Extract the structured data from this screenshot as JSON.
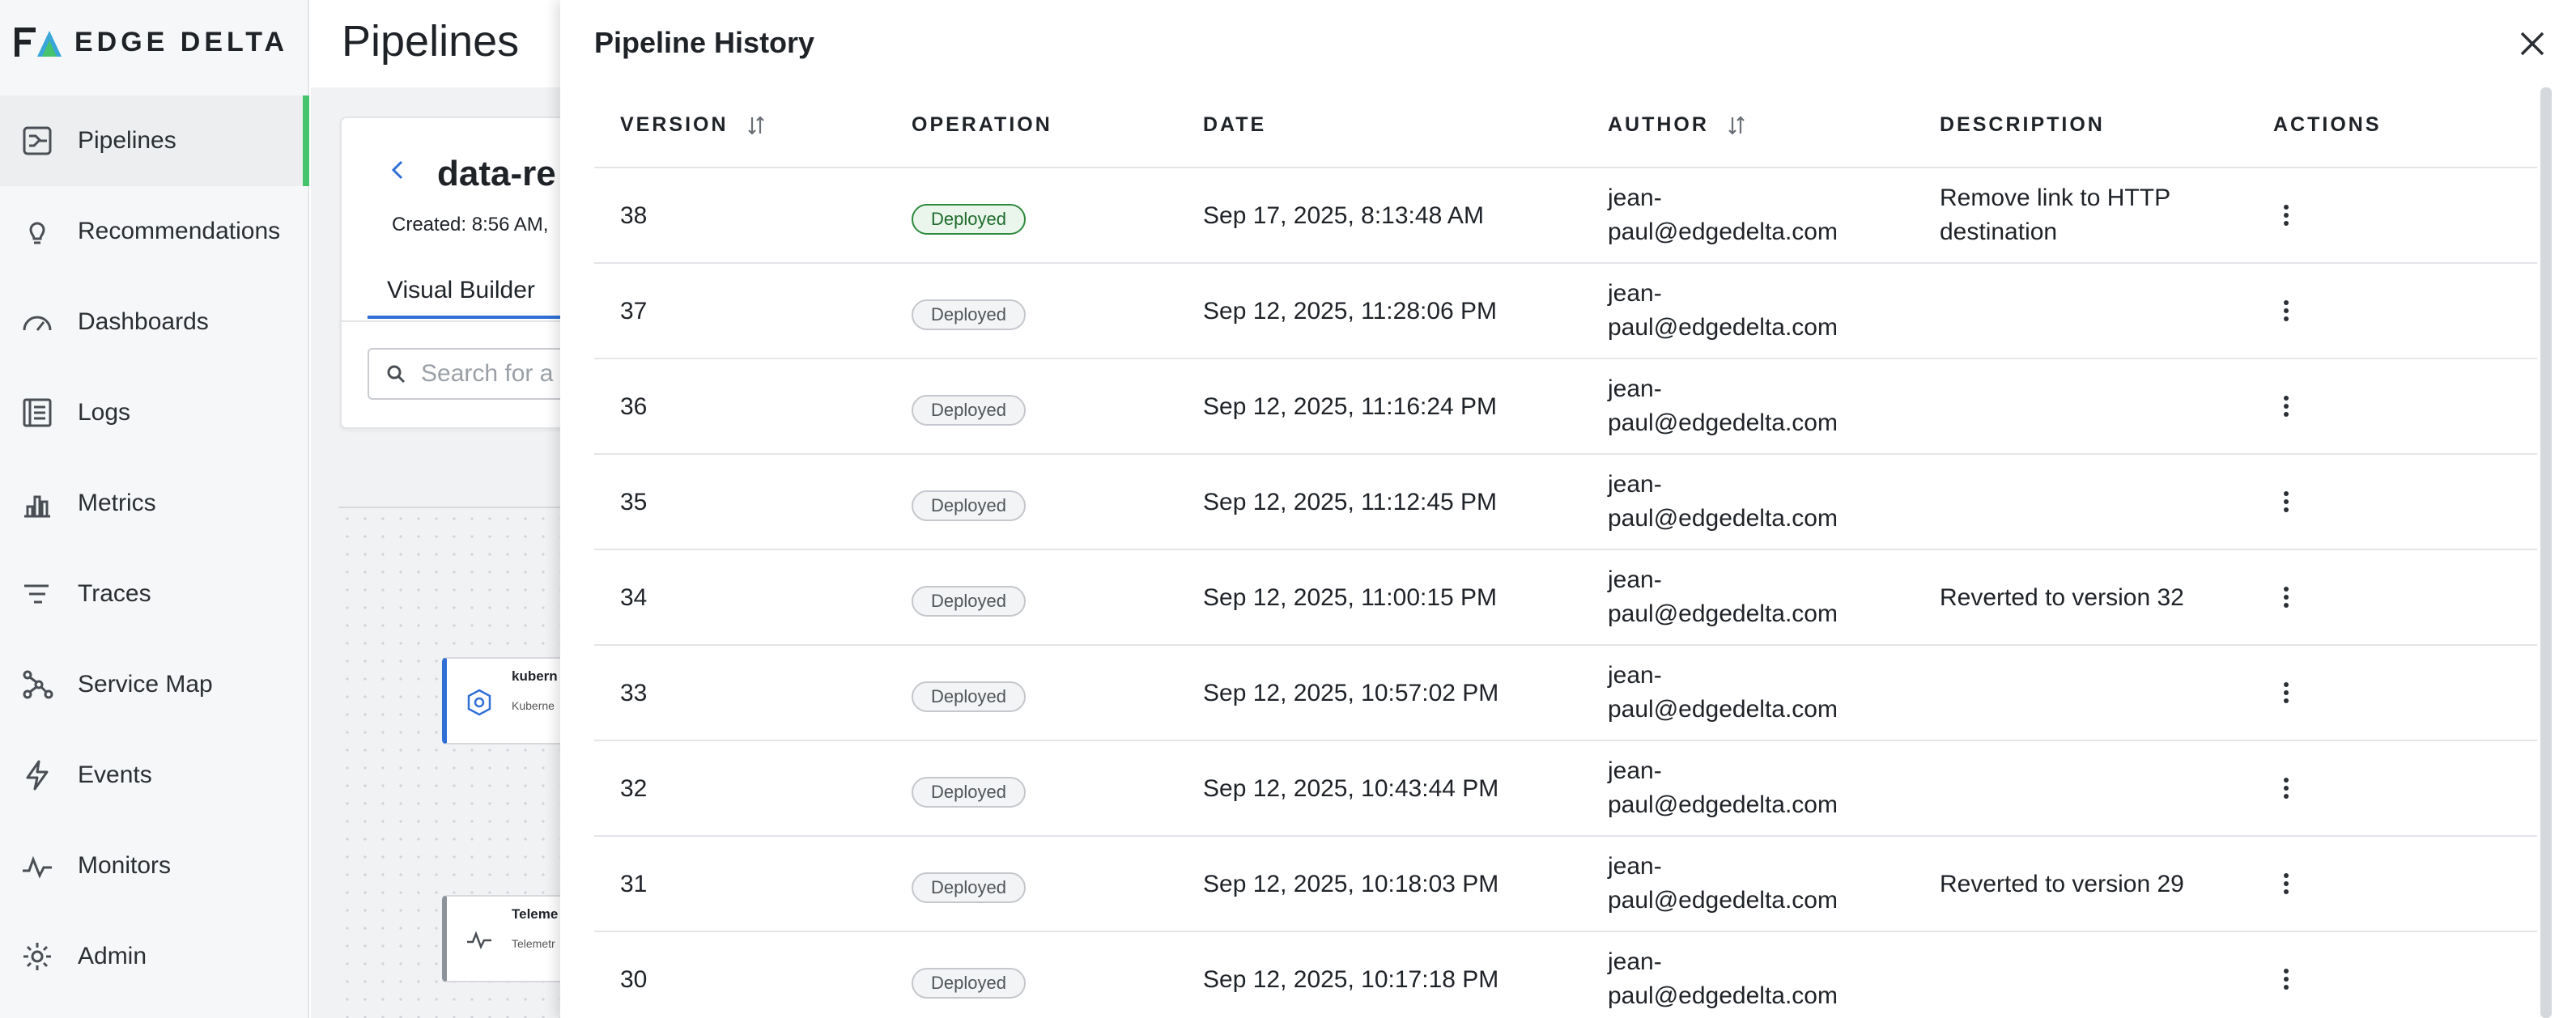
{
  "brand": {
    "name": "EDGE DELTA"
  },
  "sidebar": {
    "items": [
      {
        "label": "Pipelines",
        "icon": "pipelines-icon",
        "active": true
      },
      {
        "label": "Recommendations",
        "icon": "lightbulb-icon",
        "active": false
      },
      {
        "label": "Dashboards",
        "icon": "gauge-icon",
        "active": false
      },
      {
        "label": "Logs",
        "icon": "logs-icon",
        "active": false
      },
      {
        "label": "Metrics",
        "icon": "bar-chart-icon",
        "active": false
      },
      {
        "label": "Traces",
        "icon": "traces-icon",
        "active": false
      },
      {
        "label": "Service Map",
        "icon": "service-map-icon",
        "active": false
      },
      {
        "label": "Events",
        "icon": "lightning-icon",
        "active": false
      },
      {
        "label": "Monitors",
        "icon": "pulse-icon",
        "active": false
      },
      {
        "label": "Admin",
        "icon": "gear-icon",
        "active": false
      }
    ]
  },
  "main": {
    "page_title": "Pipelines",
    "pipeline_name": "data-re",
    "created_text": "Created: 8:56 AM,",
    "tab_label": "Visual Builder",
    "search_placeholder": "Search for a",
    "nodes": [
      {
        "title": "kubern",
        "subtitle": "Kuberne"
      },
      {
        "title": "Teleme",
        "subtitle": "Telemetr"
      }
    ]
  },
  "drawer": {
    "title": "Pipeline History",
    "columns": [
      "VERSION",
      "OPERATION",
      "DATE",
      "AUTHOR",
      "DESCRIPTION",
      "ACTIONS"
    ],
    "rows": [
      {
        "version": "38",
        "operation": "Deployed",
        "current": true,
        "date": "Sep 17, 2025, 8:13:48 AM",
        "author": "jean-paul@edgedelta.com",
        "description": "Remove link to HTTP destination"
      },
      {
        "version": "37",
        "operation": "Deployed",
        "current": false,
        "date": "Sep 12, 2025, 11:28:06 PM",
        "author": "jean-paul@edgedelta.com",
        "description": ""
      },
      {
        "version": "36",
        "operation": "Deployed",
        "current": false,
        "date": "Sep 12, 2025, 11:16:24 PM",
        "author": "jean-paul@edgedelta.com",
        "description": ""
      },
      {
        "version": "35",
        "operation": "Deployed",
        "current": false,
        "date": "Sep 12, 2025, 11:12:45 PM",
        "author": "jean-paul@edgedelta.com",
        "description": ""
      },
      {
        "version": "34",
        "operation": "Deployed",
        "current": false,
        "date": "Sep 12, 2025, 11:00:15 PM",
        "author": "jean-paul@edgedelta.com",
        "description": "Reverted to version 32"
      },
      {
        "version": "33",
        "operation": "Deployed",
        "current": false,
        "date": "Sep 12, 2025, 10:57:02 PM",
        "author": "jean-paul@edgedelta.com",
        "description": ""
      },
      {
        "version": "32",
        "operation": "Deployed",
        "current": false,
        "date": "Sep 12, 2025, 10:43:44 PM",
        "author": "jean-paul@edgedelta.com",
        "description": ""
      },
      {
        "version": "31",
        "operation": "Deployed",
        "current": false,
        "date": "Sep 12, 2025, 10:18:03 PM",
        "author": "jean-paul@edgedelta.com",
        "description": "Reverted to version 29"
      },
      {
        "version": "30",
        "operation": "Deployed",
        "current": false,
        "date": "Sep 12, 2025, 10:17:18 PM",
        "author": "jean-paul@edgedelta.com",
        "description": ""
      }
    ]
  },
  "colors": {
    "accent": "#2f6fd6",
    "active_indicator": "#46c36b",
    "current_badge": "#2e8b3e"
  }
}
